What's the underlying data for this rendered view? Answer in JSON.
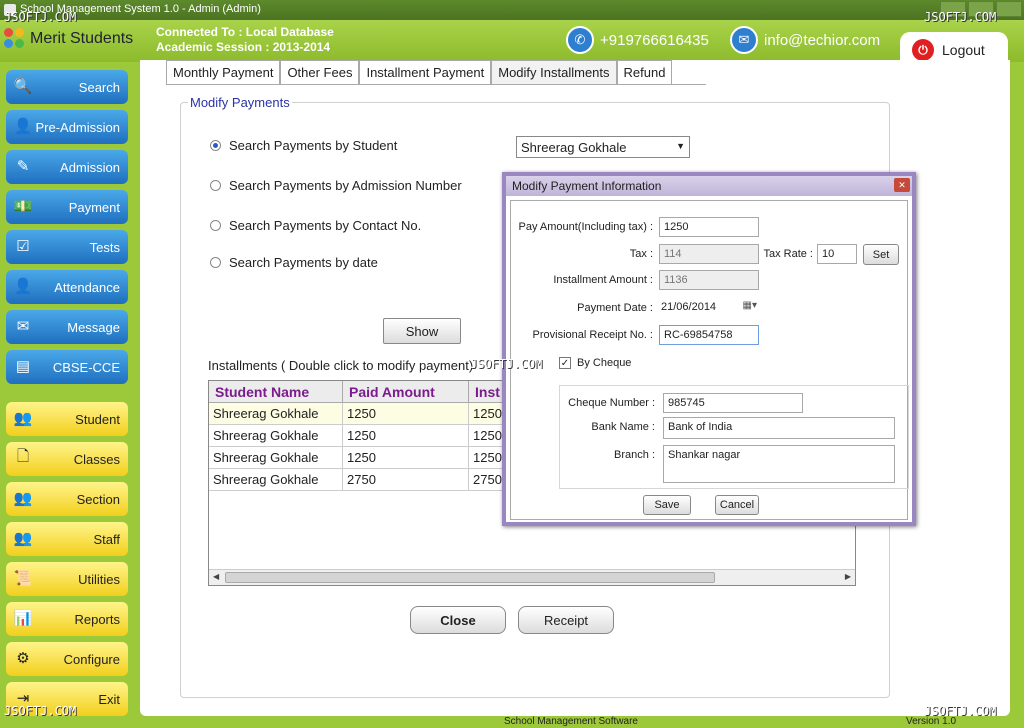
{
  "window": {
    "title": "School Management System 1.0  -  Admin (Admin)"
  },
  "watermark": "JSOFTJ.COM",
  "header": {
    "logo": "Merit Students",
    "connection": "Connected To : Local Database",
    "session": "Academic Session : 2013-2014",
    "phone": "+919766616435",
    "email": "info@techior.com",
    "logout": "Logout"
  },
  "sidebar": {
    "items": [
      {
        "label": "Search",
        "icon": "magnifier-icon"
      },
      {
        "label": "Pre-Admission",
        "icon": "person-icon"
      },
      {
        "label": "Admission",
        "icon": "pencil-icon"
      },
      {
        "label": "Payment",
        "icon": "money-icon"
      },
      {
        "label": "Tests",
        "icon": "checklist-icon"
      },
      {
        "label": "Attendance",
        "icon": "person-icon"
      },
      {
        "label": "Message",
        "icon": "envelope-icon"
      },
      {
        "label": "CBSE-CCE",
        "icon": "folder-icon"
      },
      {
        "label": "Student",
        "icon": "people-icon"
      },
      {
        "label": "Classes",
        "icon": "document-icon"
      },
      {
        "label": "Section",
        "icon": "people-icon"
      },
      {
        "label": "Staff",
        "icon": "people-icon"
      },
      {
        "label": "Utilities",
        "icon": "scroll-icon"
      },
      {
        "label": "Reports",
        "icon": "chart-icon"
      },
      {
        "label": "Configure",
        "icon": "gear-icon"
      },
      {
        "label": "Exit",
        "icon": "exit-icon"
      }
    ]
  },
  "tabs": [
    "Monthly Payment",
    "Other Fees",
    "Installment Payment",
    "Modify Installments",
    "Refund"
  ],
  "modify": {
    "legend": "Modify Payments",
    "radios": [
      "Search Payments by Student",
      "Search Payments by Admission Number",
      "Search Payments by Contact No.",
      "Search Payments by date"
    ],
    "student_select": "Shreerag  Gokhale",
    "show": "Show",
    "installments_label": "Installments ( Double click to modify payment)",
    "columns": [
      "Student Name",
      "Paid Amount",
      "Inst"
    ],
    "rows": [
      [
        "Shreerag Gokhale",
        "1250",
        "1250"
      ],
      [
        "Shreerag Gokhale",
        "1250",
        "1250"
      ],
      [
        "Shreerag Gokhale",
        "1250",
        "1250"
      ],
      [
        "Shreerag Gokhale",
        "2750",
        "2750"
      ]
    ],
    "close": "Close",
    "receipt": "Receipt"
  },
  "dialog": {
    "title": "Modify Payment Information",
    "pay_amount_label": "Pay Amount(Including tax) :",
    "pay_amount": "1250",
    "tax_label": "Tax :",
    "tax": "114",
    "tax_rate_label": "Tax Rate :",
    "tax_rate": "10",
    "set": "Set",
    "installment_label": "Installment Amount :",
    "installment": "1136",
    "date_label": "Payment Date :",
    "date": "21/06/2014",
    "receipt_label": "Provisional Receipt No. :",
    "receipt": "RC-69854758",
    "by_cheque": "By Cheque",
    "cheque_label": "Cheque Number :",
    "cheque": "985745",
    "bank_label": "Bank Name :",
    "bank": "Bank of India",
    "branch_label": "Branch :",
    "branch": "Shankar nagar",
    "save": "Save",
    "cancel": "Cancel"
  },
  "status": {
    "center": "School Management Software",
    "version": "Version 1.0"
  }
}
